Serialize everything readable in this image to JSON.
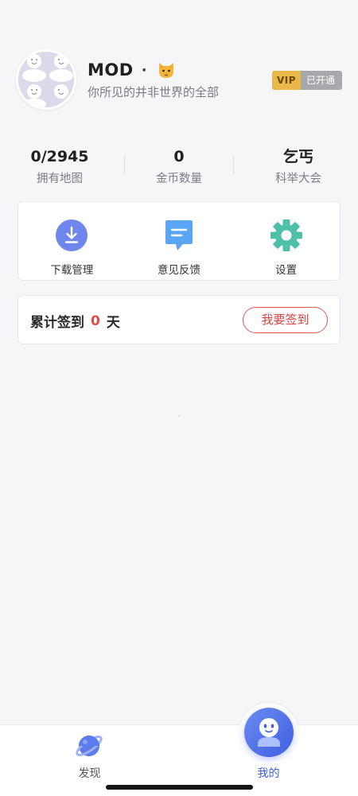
{
  "profile": {
    "username": "MOD",
    "separator": "·",
    "bio": "你所见的并非世界的全部",
    "vip": {
      "tag": "VIP",
      "status": "已开通"
    }
  },
  "stats": [
    {
      "value": "0/2945",
      "label": "拥有地图"
    },
    {
      "value": "0",
      "label": "金币数量"
    },
    {
      "value": "乞丐",
      "label": "科举大会"
    }
  ],
  "tools": [
    {
      "label": "下载管理",
      "icon": "download-icon"
    },
    {
      "label": "意见反馈",
      "icon": "feedback-icon"
    },
    {
      "label": "设置",
      "icon": "gear-icon"
    }
  ],
  "checkin": {
    "prefix": "累计签到",
    "days": "0",
    "suffix": "天",
    "button": "我要签到"
  },
  "nav": {
    "discover": "发现",
    "mine": "我的"
  },
  "colors": {
    "accent_blue": "#3e63d8",
    "checkin_red": "#e04b4b",
    "vip_gold": "#e8b84a",
    "download_icon": "#6f86ee",
    "feedback_icon": "#5aa6f5",
    "settings_icon": "#4fbfa7"
  }
}
